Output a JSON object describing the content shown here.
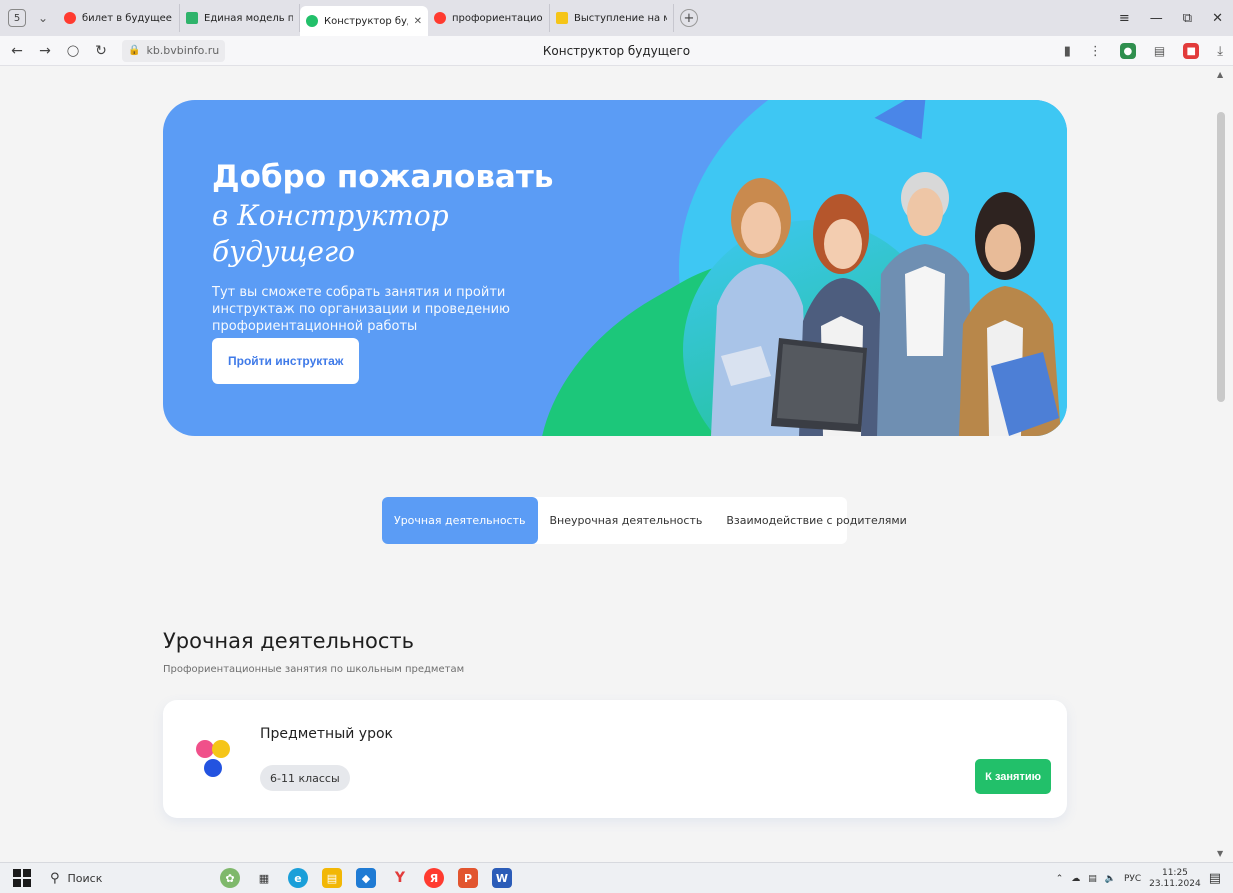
{
  "browser": {
    "tab_count": "5",
    "tabs": [
      {
        "title": "билет в будущее — Янде",
        "favicon_color": "#ff3b30",
        "active": false
      },
      {
        "title": "Единая модель профори",
        "favicon_color": "#2fb36b",
        "active": false
      },
      {
        "title": "Конструктор будущег",
        "favicon_color": "#22c06a",
        "active": true
      },
      {
        "title": "профориентационная ра",
        "favicon_color": "#ff3b30",
        "active": false
      },
      {
        "title": "Выступление на методо",
        "favicon_color": "#f5c518",
        "active": false
      }
    ],
    "url": "kb.bvbinfo.ru",
    "page_title": "Конструктор будущего"
  },
  "hero": {
    "title": "Добро пожаловать",
    "subtitle": "в Конструктор будущего",
    "description": "Тут вы сможете собрать занятия и пройти инструктаж по организации и проведению профориентационной работы",
    "button_label": "Пройти инструктаж"
  },
  "tabs": {
    "items": [
      {
        "label": "Урочная деятельность",
        "active": true
      },
      {
        "label": "Внеурочная деятельность",
        "active": false
      },
      {
        "label": "Взаимодействие с родителями",
        "active": false
      }
    ]
  },
  "section": {
    "title": "Урочная деятельность",
    "subtitle": "Профориентационные занятия по школьным предметам"
  },
  "card": {
    "title": "Предметный урок",
    "grades": "6-11 классы",
    "button_label": "К занятию"
  },
  "taskbar": {
    "search_placeholder": "Поиск",
    "language": "РУС",
    "time": "11:25",
    "date": "23.11.2024"
  },
  "colors": {
    "hero_blue": "#5b9cf5",
    "hero_cyan": "#3ec7f3",
    "hero_green": "#1cc77a",
    "accent_green": "#22c06a",
    "tab_active": "#5b9cf5"
  }
}
